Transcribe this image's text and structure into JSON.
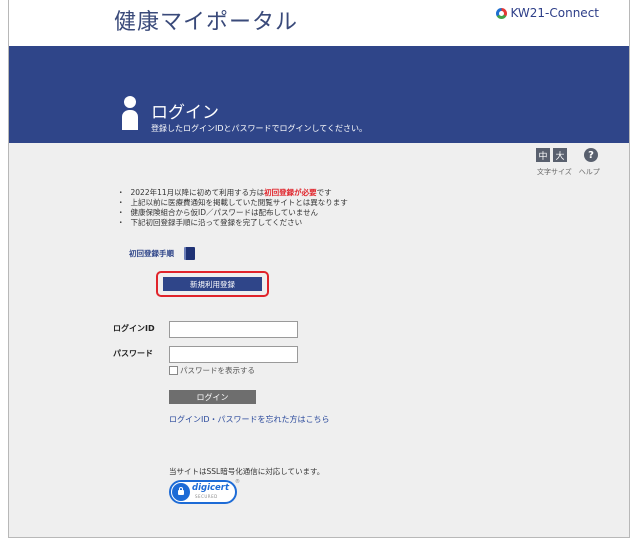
{
  "header": {
    "site_title": "健康マイポータル",
    "brand_label": "KW21-Connect"
  },
  "banner": {
    "heading": "ログイン",
    "subtitle": "登録したログインIDとパスワードでログインしてください。"
  },
  "tools": {
    "font_medium": "中",
    "font_large": "大",
    "font_size_label": "文字サイズ",
    "help_symbol": "?",
    "help_label": "ヘルプ"
  },
  "notices": [
    {
      "before": "2022年11月以降に初めて利用する方は",
      "highlight": "初回登録が必要",
      "after": "です"
    },
    {
      "before": "上記以前に医療費通知を掲載していた閲覧サイトとは異なります",
      "highlight": "",
      "after": ""
    },
    {
      "before": "健康保険組合から仮ID／パスワードは配布していません",
      "highlight": "",
      "after": ""
    },
    {
      "before": "下記初回登録手順に沿って登録を完了してください",
      "highlight": "",
      "after": ""
    }
  ],
  "guide": {
    "label": "初回登録手順"
  },
  "register_button": "新規利用登録",
  "form": {
    "login_id_label": "ログインID",
    "login_id_value": "",
    "password_label": "パスワード",
    "password_value": "",
    "show_password_label": "パスワードを表示する",
    "login_button": "ログイン",
    "forgot_link": "ログインID・パスワードを忘れた方はこちら"
  },
  "ssl": {
    "text": "当サイトはSSL暗号化通信に対応しています。",
    "badge_name": "digicert",
    "badge_sub": "SECURED",
    "badge_mark": "®"
  },
  "colors": {
    "banner": "#2f4589",
    "accent_red": "#e0242b",
    "link": "#2b4a9c"
  }
}
